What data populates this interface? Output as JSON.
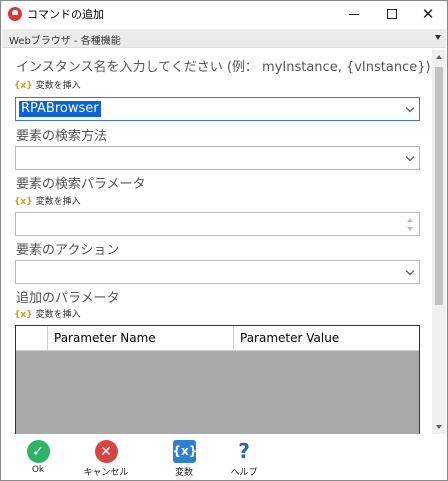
{
  "window": {
    "title": "コマンドの追加"
  },
  "category": {
    "label": "Webブラウザ - 各種機能"
  },
  "form": {
    "instance": {
      "label": "インスタンス名を入力してください (例： myInstance, {vInstance})",
      "insert": "変数を挿入",
      "value": "RPABrowser"
    },
    "search_method": {
      "label": "要素の検索方法",
      "value": ""
    },
    "search_param": {
      "label": "要素の検索パラメータ",
      "insert": "変数を挿入",
      "value": ""
    },
    "action": {
      "label": "要素のアクション",
      "value": ""
    },
    "extra_params": {
      "label": "追加のパラメータ",
      "insert": "変数を挿入",
      "columns": [
        "Parameter Name",
        "Parameter Value"
      ]
    }
  },
  "insert_bracket": "{x}",
  "footer": {
    "ok": "Ok",
    "cancel": "キャンセル",
    "variables": "変数",
    "variables_icon": "{x}",
    "help": "ヘルプ"
  },
  "colors": {
    "ok": "#2fb36b",
    "cancel": "#d64541",
    "variables": "#2f7fd0",
    "help": "#2a66b8",
    "selection": "#0a64d6"
  }
}
